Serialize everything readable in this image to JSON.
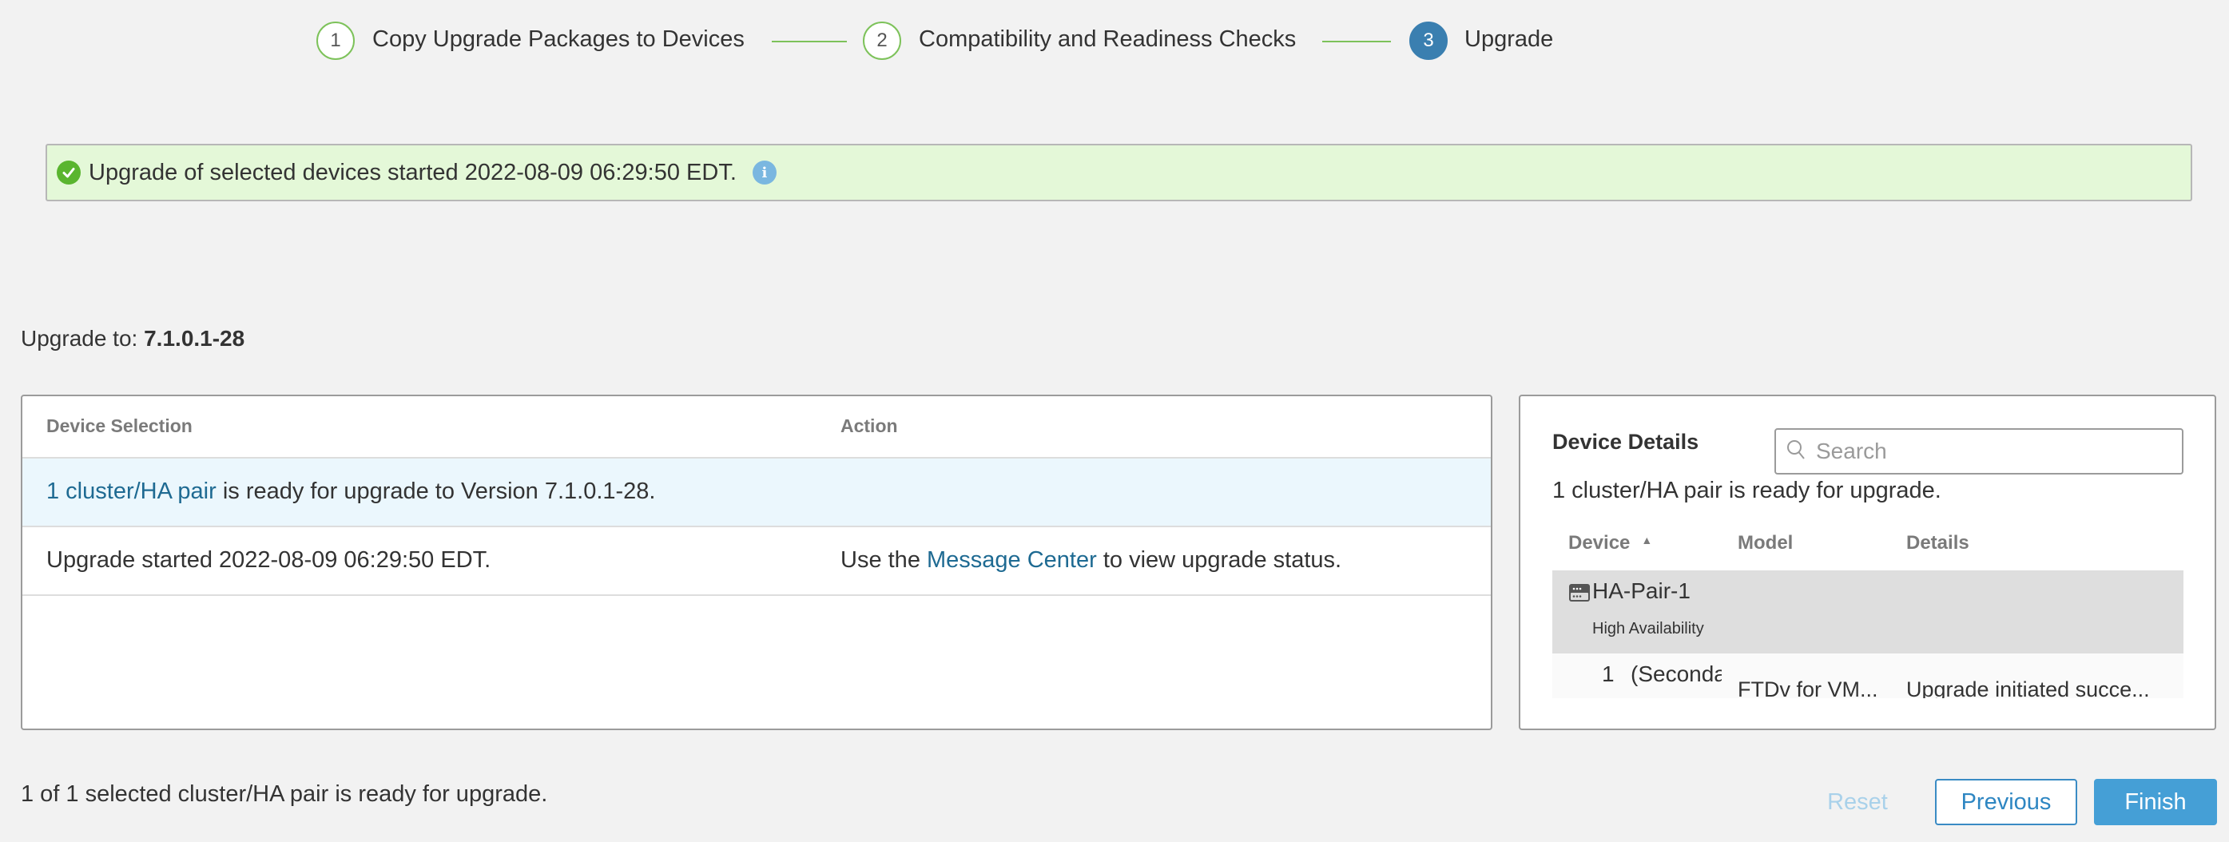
{
  "stepper": {
    "steps": [
      {
        "number": "1",
        "label": "Copy Upgrade Packages to Devices",
        "state": "completed"
      },
      {
        "number": "2",
        "label": "Compatibility and Readiness Checks",
        "state": "completed"
      },
      {
        "number": "3",
        "label": "Upgrade",
        "state": "active"
      }
    ]
  },
  "banner": {
    "icon": "check-circle-icon",
    "message": "Upgrade of selected devices started 2022-08-09 06:29:50 EDT.",
    "info_icon": "i"
  },
  "upgrade_to": {
    "label": "Upgrade to:",
    "version": "7.1.0.1-28"
  },
  "device_selection_table": {
    "columns": [
      "Device Selection",
      "Action"
    ],
    "rows": [
      {
        "selection_link": "1 cluster/HA pair",
        "selection_text": " is ready for upgrade to Version 7.1.0.1-28.",
        "action_prefix": "",
        "action_link": "",
        "action_suffix": ""
      },
      {
        "selection_link": "",
        "selection_text": "Upgrade started 2022-08-09 06:29:50 EDT.",
        "action_prefix": "Use the ",
        "action_link": "Message Center",
        "action_suffix": " to view upgrade status."
      }
    ]
  },
  "device_details": {
    "title": "Device Details",
    "search_placeholder": "Search",
    "search_value": "",
    "summary": "1 cluster/HA pair is ready for upgrade.",
    "columns": [
      "Device",
      "Model",
      "Details"
    ],
    "sort_indicator": "▲",
    "group": {
      "name": "HA-Pair-1",
      "type": "High Availability"
    },
    "child": {
      "index": "1",
      "device": "(Secondary)",
      "model": "FTDv for VM...",
      "details": "Upgrade initiated succe..."
    }
  },
  "footer": {
    "status": "1 of 1 selected cluster/HA pair is ready for upgrade.",
    "reset_label": "Reset",
    "previous_label": "Previous",
    "finish_label": "Finish"
  },
  "colors": {
    "step_complete": "#7dc25a",
    "step_active": "#3a7fb0",
    "banner_bg": "#e4f8d8",
    "link": "#1e6a92",
    "primary_button": "#459fd6"
  }
}
